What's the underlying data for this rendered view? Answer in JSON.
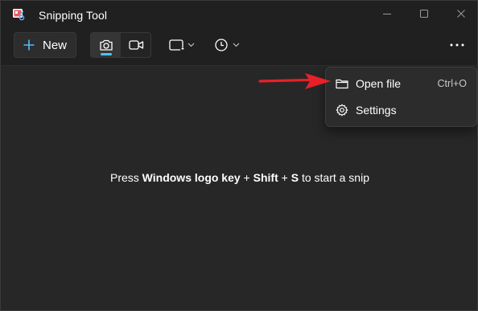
{
  "window": {
    "title": "Snipping Tool",
    "controls": {
      "minimize_icon": "minimize-icon",
      "maximize_icon": "maximize-icon",
      "close_icon": "close-icon"
    }
  },
  "toolbar": {
    "new_label": "New",
    "new_icon": "plus-icon",
    "modes": [
      {
        "icon": "camera-icon",
        "selected": true
      },
      {
        "icon": "video-camera-icon",
        "selected": false
      }
    ],
    "shape_icon": "rectangle-snip-icon",
    "timer_icon": "clock-icon",
    "more_icon": "more-horizontal-icon"
  },
  "main": {
    "hint": {
      "prefix": "Press ",
      "key1": "Windows logo key",
      "sep1": " + ",
      "key2": "Shift",
      "sep2": " + ",
      "key3": "S",
      "suffix": " to start a snip"
    }
  },
  "menu": {
    "items": [
      {
        "label": "Open file",
        "shortcut": "Ctrl+O",
        "icon": "folder-icon"
      },
      {
        "label": "Settings",
        "shortcut": "",
        "icon": "gear-icon"
      }
    ]
  },
  "colors": {
    "accent": "#4cc2ff",
    "annotation_arrow": "#e8202a",
    "background": "#272727",
    "titlebar": "#202020"
  }
}
